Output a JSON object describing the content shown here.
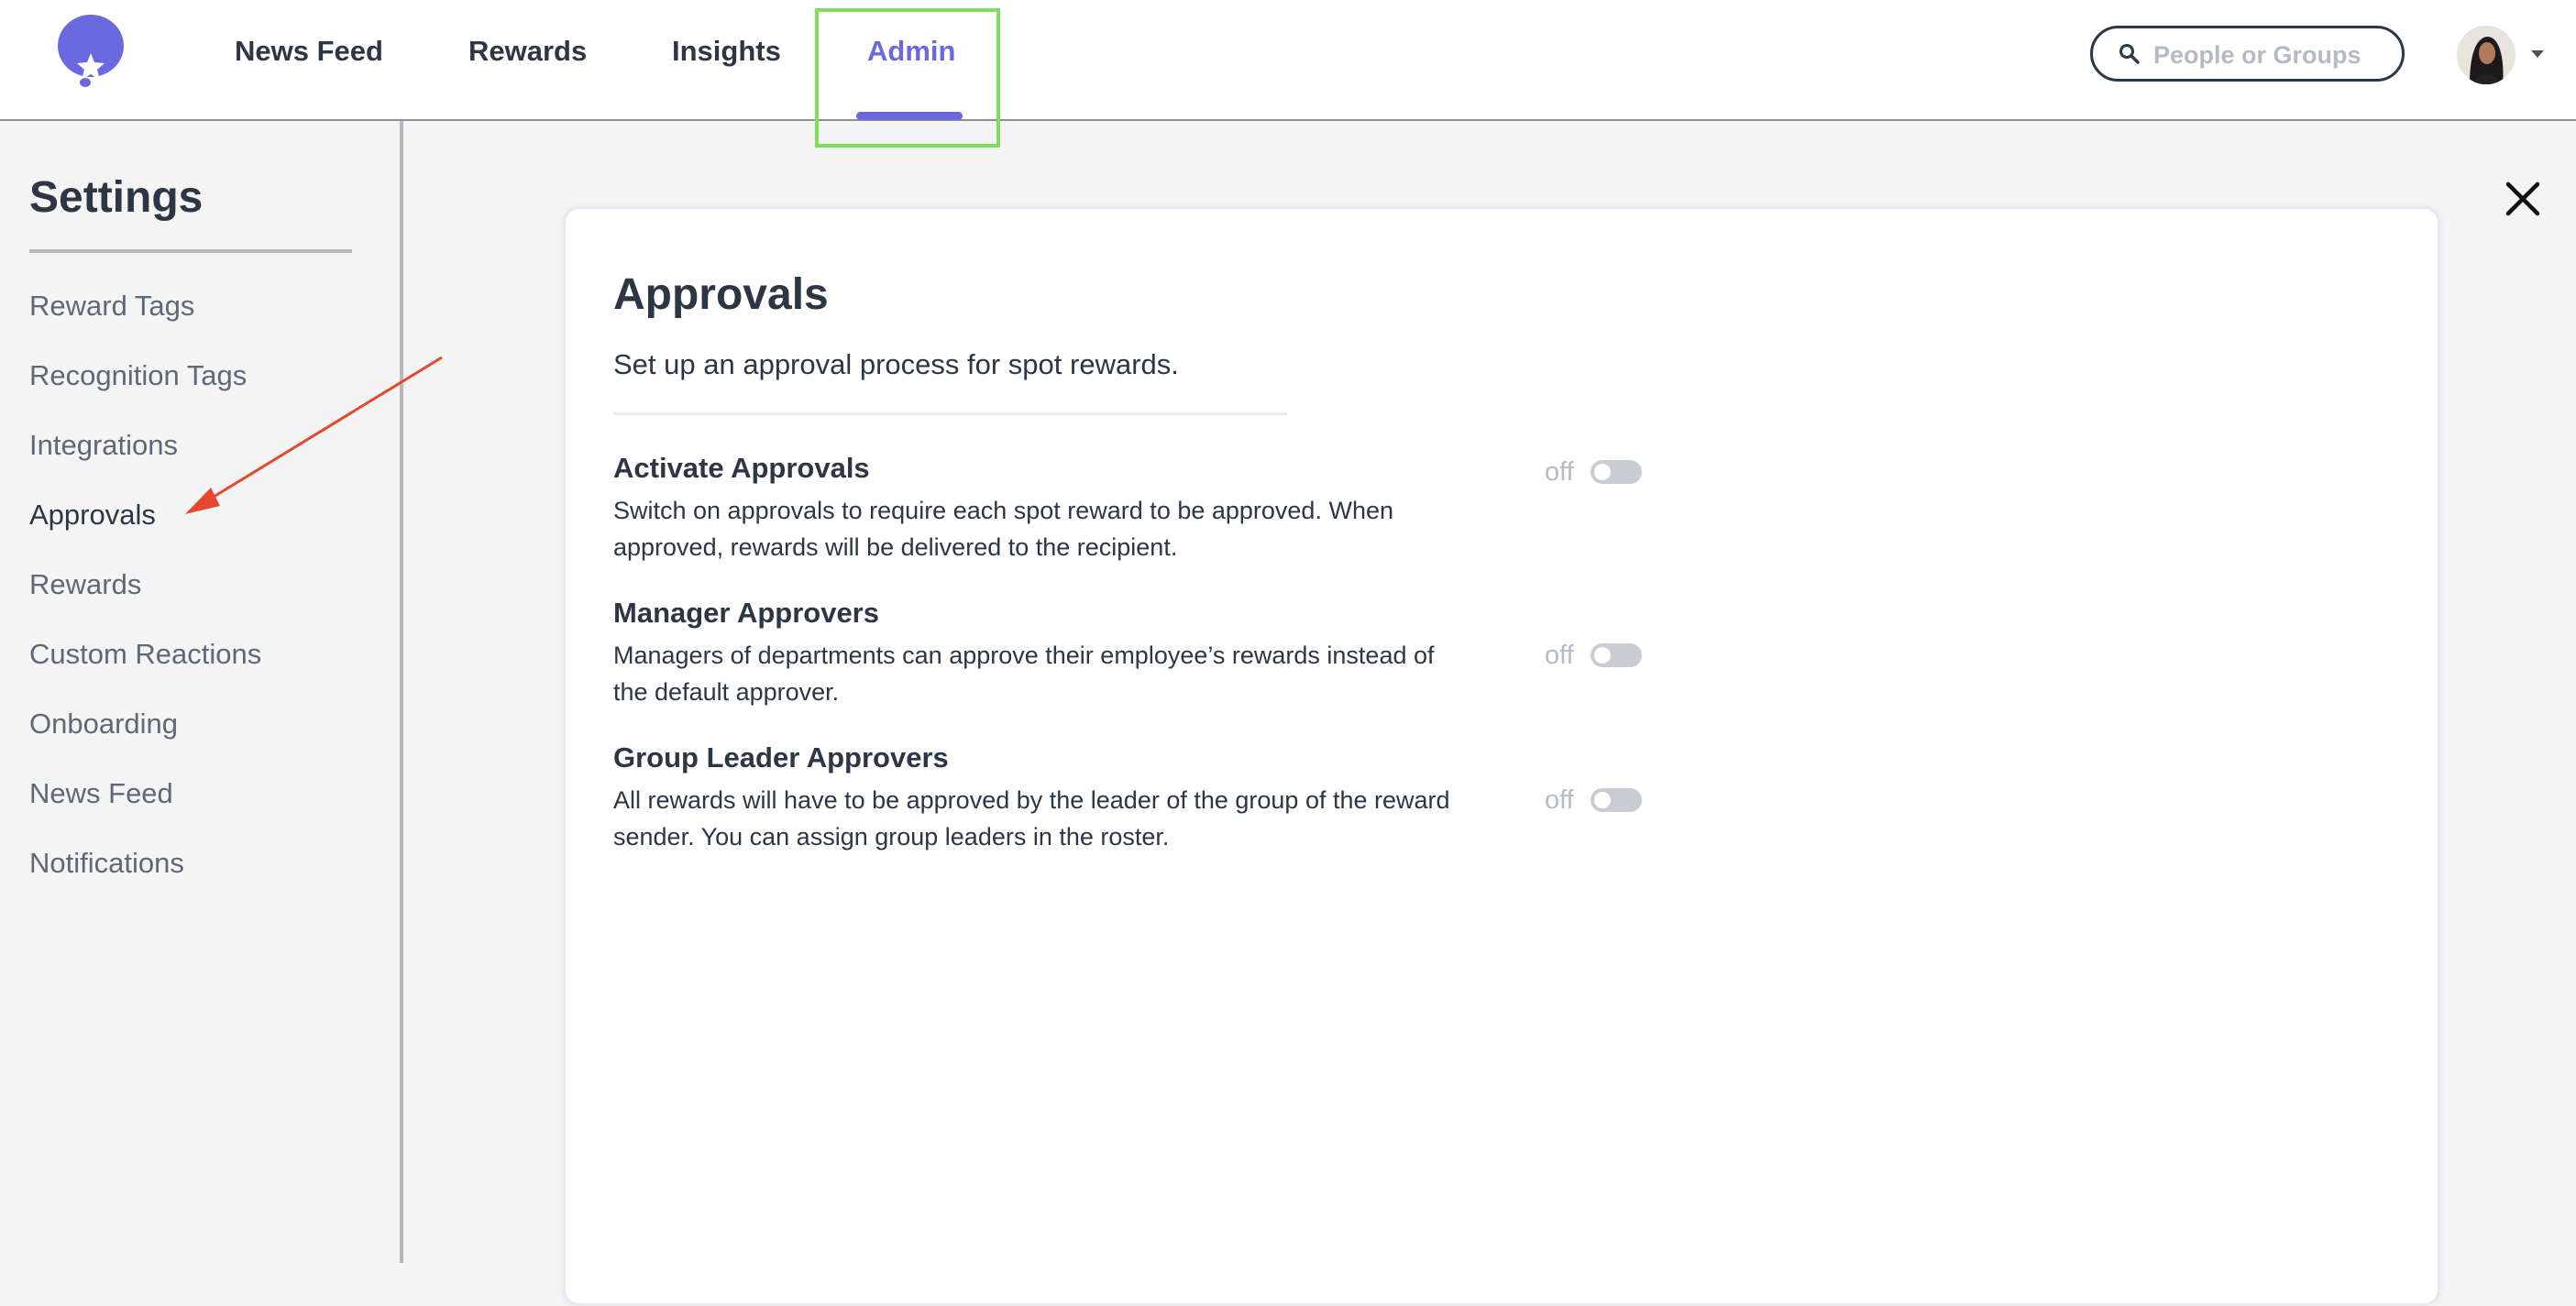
{
  "nav": {
    "items": [
      {
        "label": "News Feed",
        "active": false
      },
      {
        "label": "Rewards",
        "active": false
      },
      {
        "label": "Insights",
        "active": false
      },
      {
        "label": "Admin",
        "active": true
      }
    ],
    "search": {
      "placeholder": "People or Groups",
      "value": ""
    },
    "icons": {
      "logo": "balloon-logo-icon",
      "search": "search-icon",
      "caret": "caret-down-icon"
    }
  },
  "sidebar": {
    "title": "Settings",
    "items": [
      {
        "label": "Reward Tags"
      },
      {
        "label": "Recognition Tags"
      },
      {
        "label": "Integrations"
      },
      {
        "label": "Approvals",
        "active": true
      },
      {
        "label": "Rewards"
      },
      {
        "label": "Custom Reactions"
      },
      {
        "label": "Onboarding"
      },
      {
        "label": "News Feed"
      },
      {
        "label": "Notifications"
      }
    ]
  },
  "main": {
    "close_icon": "close-icon",
    "title": "Approvals",
    "subtitle": "Set up an approval process for spot rewards.",
    "settings": [
      {
        "title": "Activate Approvals",
        "description": "Switch on approvals to require each spot reward to be approved. When approved, rewards will be delivered to the recipient.",
        "state_label": "off",
        "enabled": false
      },
      {
        "title": "Manager Approvers",
        "description": "Managers of departments can approve their employee’s rewards instead of the default approver.",
        "state_label": "off",
        "enabled": false
      },
      {
        "title": "Group Leader Approvers",
        "description": "All rewards will have to be approved by the leader of the group of the reward sender. You can assign group leaders in the roster.",
        "state_label": "off",
        "enabled": false
      }
    ]
  },
  "colors": {
    "accent": "#6a69e0",
    "text": "#2c3645",
    "muted": "#5e6877",
    "highlight_box": "#7ee05a",
    "annotation_arrow": "#e5472f"
  }
}
